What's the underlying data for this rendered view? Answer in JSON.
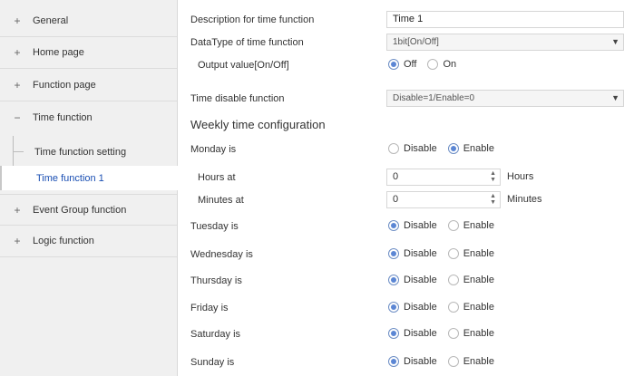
{
  "sidebar": {
    "items": [
      {
        "sign": "+",
        "label": "General"
      },
      {
        "sign": "+",
        "label": "Home page"
      },
      {
        "sign": "+",
        "label": "Function page"
      },
      {
        "sign": "−",
        "label": "Time function"
      },
      {
        "sign": "+",
        "label": "Event Group function"
      },
      {
        "sign": "+",
        "label": "Logic function"
      }
    ],
    "subitems": [
      {
        "label": "Time function setting"
      },
      {
        "label": "Time function 1"
      }
    ]
  },
  "main": {
    "description": {
      "label": "Description for time function",
      "value": "Time 1"
    },
    "datatype": {
      "label": "DataType of time function",
      "value": "1bit[On/Off]"
    },
    "output": {
      "label": "Output value[On/Off]",
      "opt1": "Off",
      "opt2": "On",
      "selected": "Off"
    },
    "disable_fn": {
      "label": "Time disable function",
      "value": "Disable=1/Enable=0"
    },
    "weekly_title": "Weekly time configuration",
    "days": [
      {
        "label": "Monday is",
        "selected": "Enable"
      },
      {
        "label": "Tuesday is",
        "selected": "Disable"
      },
      {
        "label": "Wednesday is",
        "selected": "Disable"
      },
      {
        "label": "Thursday is",
        "selected": "Disable"
      },
      {
        "label": "Friday is",
        "selected": "Disable"
      },
      {
        "label": "Saturday is",
        "selected": "Disable"
      },
      {
        "label": "Sunday is",
        "selected": "Disable"
      }
    ],
    "opt_disable": "Disable",
    "opt_enable": "Enable",
    "hours": {
      "label": "Hours at",
      "value": "0",
      "unit": "Hours"
    },
    "minutes": {
      "label": "Minutes at",
      "value": "0",
      "unit": "Minutes"
    }
  },
  "colors": {
    "accent": "#5b86d4",
    "active_link": "#1a4fb3",
    "sidebar_bg": "#f0f0f0"
  }
}
